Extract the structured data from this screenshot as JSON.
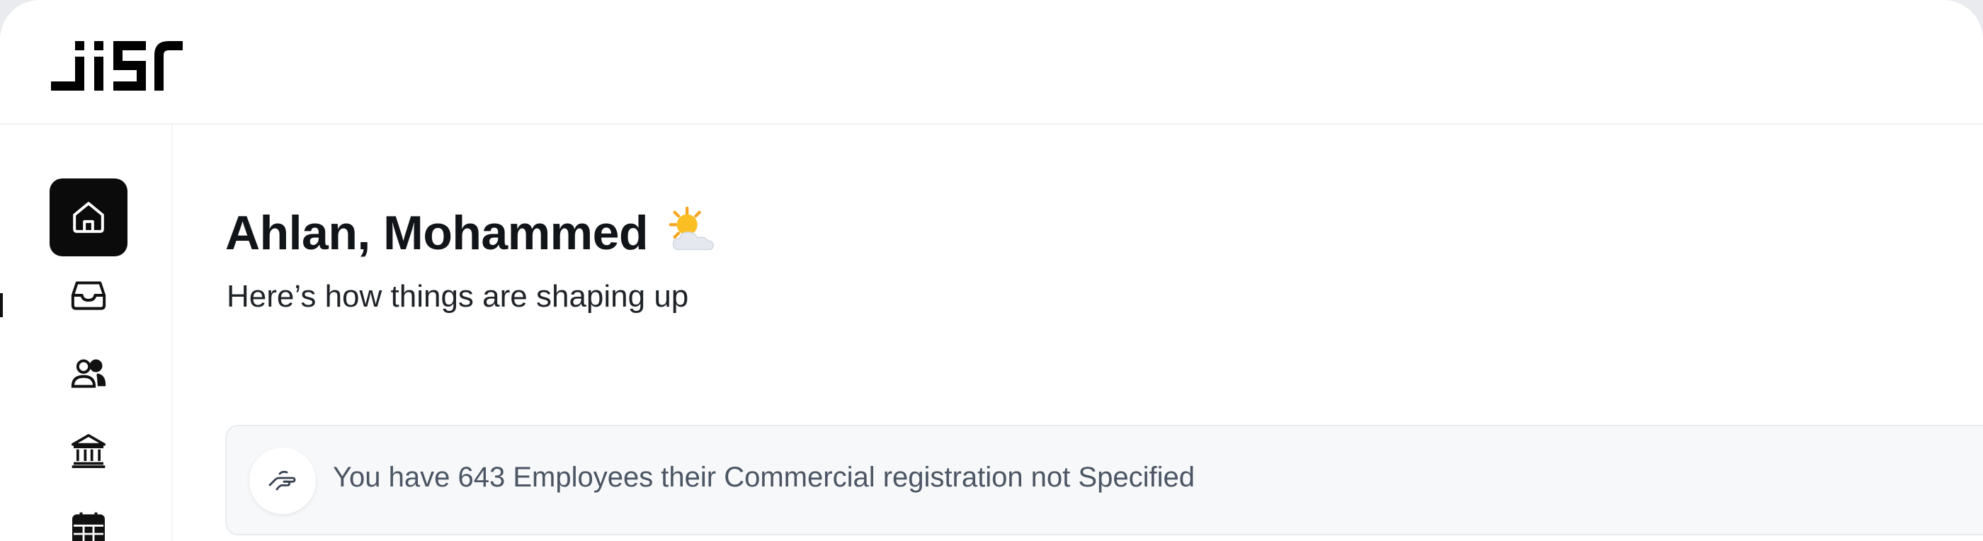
{
  "app": {
    "logo_text": "JISR"
  },
  "sidebar": {
    "items": [
      {
        "name": "home",
        "icon": "home-icon",
        "active": true
      },
      {
        "name": "inbox",
        "icon": "inbox-icon",
        "active": false
      },
      {
        "name": "employees",
        "icon": "users-icon",
        "active": false
      },
      {
        "name": "organization",
        "icon": "bank-icon",
        "active": false
      },
      {
        "name": "calendar",
        "icon": "calendar-icon",
        "active": false
      }
    ]
  },
  "main": {
    "greeting": "Ahlan, Mohammed",
    "greeting_icon": "sun-behind-cloud-icon",
    "subtitle": "Here’s how things are shaping up",
    "banner": {
      "icon": "hand-pointing-icon",
      "text": "You have 643 Employees their Commercial registration not Specified"
    }
  },
  "colors": {
    "active_nav": "#0b0b0b",
    "banner_bg": "#f6f8fa",
    "banner_text": "#4b5563"
  }
}
